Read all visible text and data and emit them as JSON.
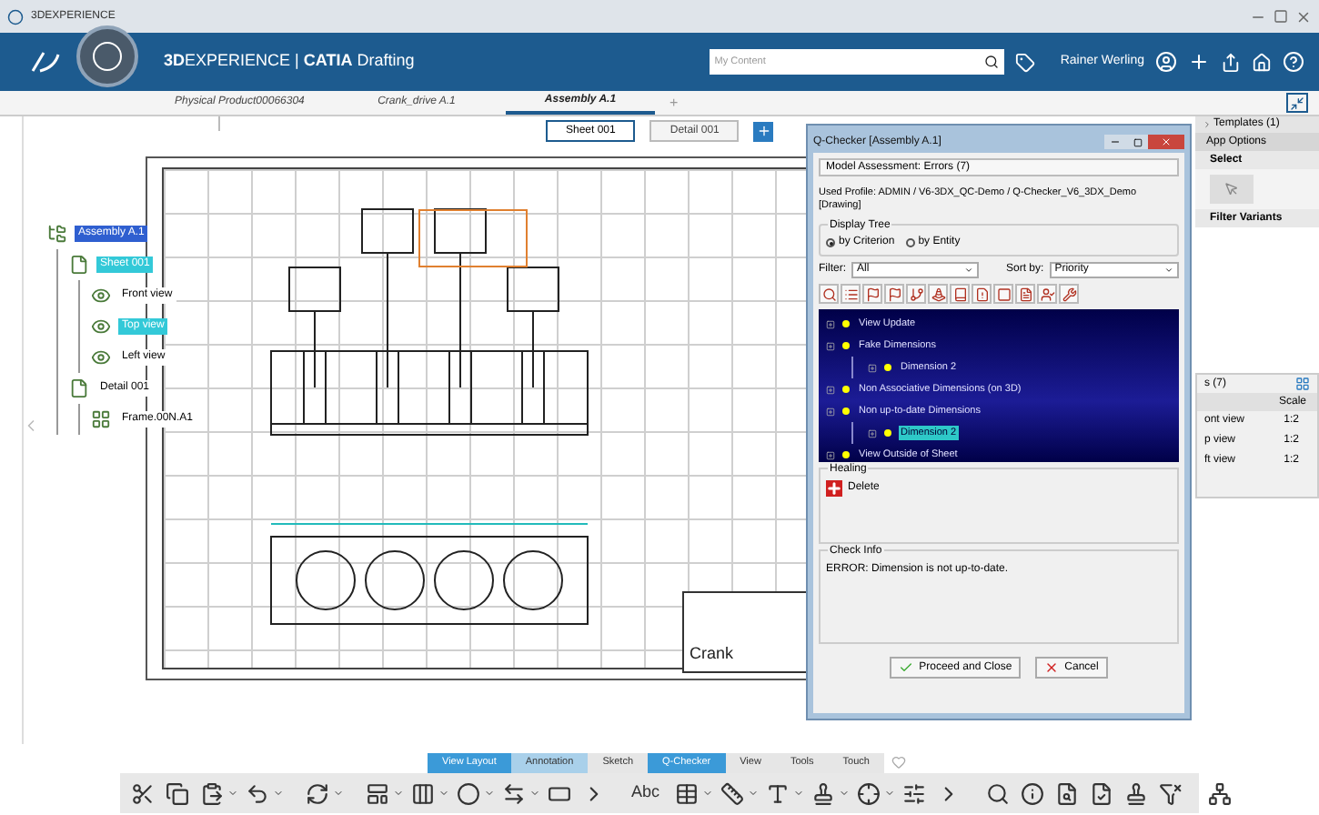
{
  "window": {
    "title": "3DEXPERIENCE"
  },
  "header": {
    "brand": "**3D**EXPERIENCE | **CATIA** Drafting",
    "search": {
      "placeholder": "My Content"
    },
    "user": "Rainer Werling"
  },
  "doc_tabs": [
    {
      "label": "Physical Product00066304",
      "selected": false
    },
    {
      "label": "Crank_drive A.1",
      "selected": false
    },
    {
      "label": "Assembly A.1",
      "selected": true
    }
  ],
  "new_tab": "+",
  "sheet_tabs": [
    {
      "label": "Sheet 001",
      "selected": true
    },
    {
      "label": "Detail 001",
      "selected": false
    }
  ],
  "tree": [
    {
      "label": "Assembly A.1",
      "kind": "root",
      "selected": true,
      "children": [
        {
          "label": "Sheet 001",
          "kind": "sheet",
          "selected": true,
          "children": [
            {
              "label": "Front view",
              "kind": "view",
              "selected": false
            },
            {
              "label": "Top view",
              "kind": "view",
              "selected": true
            },
            {
              "label": "Left view",
              "kind": "view",
              "selected": false
            }
          ]
        },
        {
          "label": "Detail 001",
          "kind": "sheet",
          "selected": false,
          "children": [
            {
              "label": "Frame.00N.A1",
              "kind": "detail",
              "selected": false
            }
          ]
        }
      ]
    }
  ],
  "drawing": {
    "title_block": "Crank"
  },
  "right_panel": {
    "templates": "Templates (1)",
    "app_options": "App Options",
    "select": "Select",
    "filter_variants": "Filter Variants",
    "list": {
      "title": "s (7)",
      "column": "Scale",
      "rows": [
        {
          "name": "ont view",
          "scale": "1:2"
        },
        {
          "name": "p view",
          "scale": "1:2"
        },
        {
          "name": "ft view",
          "scale": "1:2"
        }
      ]
    }
  },
  "dialog": {
    "title": "Q-Checker [Assembly A.1]",
    "assessment": "Model Assessment: Errors (7)",
    "profile": "Used Profile: ADMIN / V6-3DX_QC-Demo / Q-Checker_V6_3DX_Demo [Drawing]",
    "display_tree": {
      "label": "Display Tree",
      "options": [
        {
          "label": "by Criterion",
          "selected": true
        },
        {
          "label": "by Entity",
          "selected": false
        }
      ]
    },
    "filter": {
      "label": "Filter:",
      "value": "All"
    },
    "sort": {
      "label": "Sort by:",
      "value": "Priority"
    },
    "results": [
      {
        "label": "View Update",
        "selected": false
      },
      {
        "label": "Fake Dimensions",
        "selected": false,
        "children": [
          {
            "label": "Dimension 2",
            "selected": false
          }
        ]
      },
      {
        "label": "Non Associative Dimensions (on 3D)",
        "selected": false
      },
      {
        "label": "Non up-to-date Dimensions",
        "selected": false,
        "children": [
          {
            "label": "Dimension 2",
            "selected": true
          }
        ]
      },
      {
        "label": "View Outside of Sheet",
        "selected": false
      }
    ],
    "healing": {
      "label": "Healing",
      "action": "Delete"
    },
    "check_info": {
      "label": "Check Info",
      "text": "ERROR: Dimension is not up-to-date."
    },
    "buttons": [
      {
        "label": "Proceed and Close",
        "kind": "ok"
      },
      {
        "label": "Cancel",
        "kind": "cancel"
      }
    ]
  },
  "bottom_tabs": [
    {
      "label": "View Layout",
      "selected": true,
      "hovered": false
    },
    {
      "label": "Annotation",
      "selected": false,
      "hovered": true
    },
    {
      "label": "Sketch",
      "selected": false,
      "hovered": false
    },
    {
      "label": "Q-Checker",
      "selected": true,
      "hovered": false
    },
    {
      "label": "View",
      "selected": false,
      "hovered": false
    },
    {
      "label": "Tools",
      "selected": false,
      "hovered": false
    },
    {
      "label": "Touch",
      "selected": false,
      "hovered": false
    }
  ],
  "toolbar": {
    "text_tool": "Abc"
  }
}
